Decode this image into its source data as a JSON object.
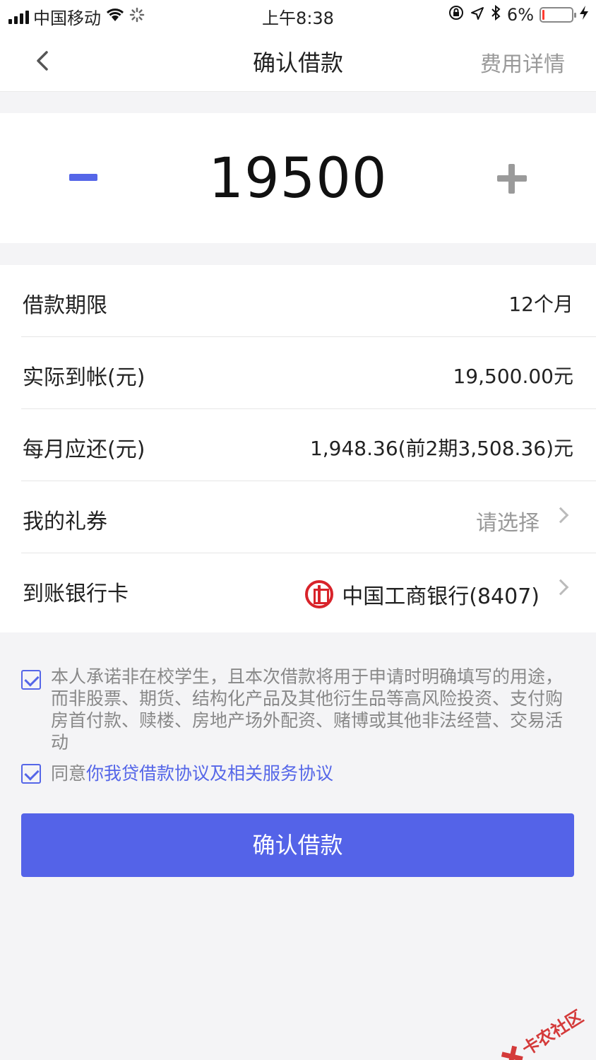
{
  "status_bar": {
    "carrier": "中国移动",
    "time": "上午8:38",
    "battery_percent": "6%",
    "battery_level": 0.06,
    "battery_color": "#ff3b30"
  },
  "nav": {
    "back_icon": "chevron-left-icon",
    "title": "确认借款",
    "right_action": "费用详情"
  },
  "amount": {
    "value": "19500",
    "minus_icon": "minus-icon",
    "plus_icon": "plus-icon",
    "minus_color": "#5566e8",
    "plus_color": "#9a9a9a"
  },
  "details": {
    "term": {
      "label": "借款期限",
      "value": "12个月"
    },
    "received": {
      "label": "实际到帐(元)",
      "value": "19,500.00元"
    },
    "monthly": {
      "label": "每月应还(元)",
      "value": "1,948.36(前2期3,508.36)元"
    },
    "coupon": {
      "label": "我的礼券",
      "value": "请选择"
    },
    "bank": {
      "label": "到账银行卡",
      "value": "中国工商银行(8407)",
      "logo_icon": "icbc-logo-icon"
    }
  },
  "agreements": {
    "promise": {
      "checked": true,
      "text": "本人承诺非在校学生，且本次借款将用于申请时明确填写的用途，而非股票、期货、结构化产品及其他衍生品等高风险投资、支付购房首付款、赎楼、房地产场外配资、赌博或其他非法经营、交易活动"
    },
    "terms": {
      "checked": true,
      "prefix": "同意",
      "link": "你我贷借款协议及相关服务协议"
    }
  },
  "submit": {
    "label": "确认借款",
    "color": "#5463e8"
  },
  "watermark": {
    "text": "卡农社区"
  }
}
